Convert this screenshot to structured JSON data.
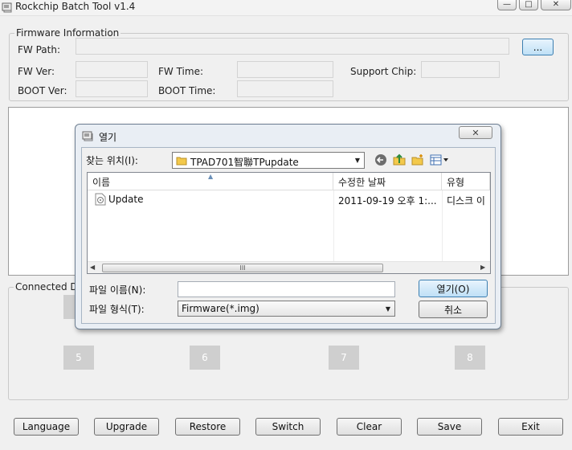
{
  "window": {
    "title": "Rockchip Batch Tool v1.4",
    "minimize_glyph": "—",
    "maximize_glyph": "□",
    "close_glyph": "✕"
  },
  "firmware_info": {
    "group_title": "Firmware Information",
    "fw_path_label": "FW Path:",
    "browse_label": "...",
    "fw_ver_label": "FW Ver:",
    "fw_time_label": "FW Time:",
    "support_chip_label": "Support Chip:",
    "boot_ver_label": "BOOT Ver:",
    "boot_time_label": "BOOT Time:"
  },
  "connected_devices": {
    "group_title": "Connected De",
    "devices": [
      "5",
      "6",
      "7",
      "8"
    ]
  },
  "buttons": {
    "language": "Language",
    "upgrade": "Upgrade",
    "restore": "Restore",
    "switch": "Switch",
    "clear": "Clear",
    "save": "Save",
    "exit": "Exit"
  },
  "open_dialog": {
    "title": "열기",
    "close_glyph": "✕",
    "look_in_label": "찾는 위치(I):",
    "look_in_value": "TPAD701智聯TPupdate",
    "columns": {
      "name": "이름",
      "date": "수정한 날짜",
      "type": "유형"
    },
    "files": [
      {
        "name": "Update",
        "date": "2011-09-19 오후 1:...",
        "type": "디스크 이"
      }
    ],
    "scroll_grip": "III",
    "file_name_label": "파일 이름(N):",
    "file_name_value": "",
    "file_type_label": "파일 형식(T):",
    "file_type_value": "Firmware(*.img)",
    "open_button": "열기(O)",
    "cancel_button": "취소"
  }
}
